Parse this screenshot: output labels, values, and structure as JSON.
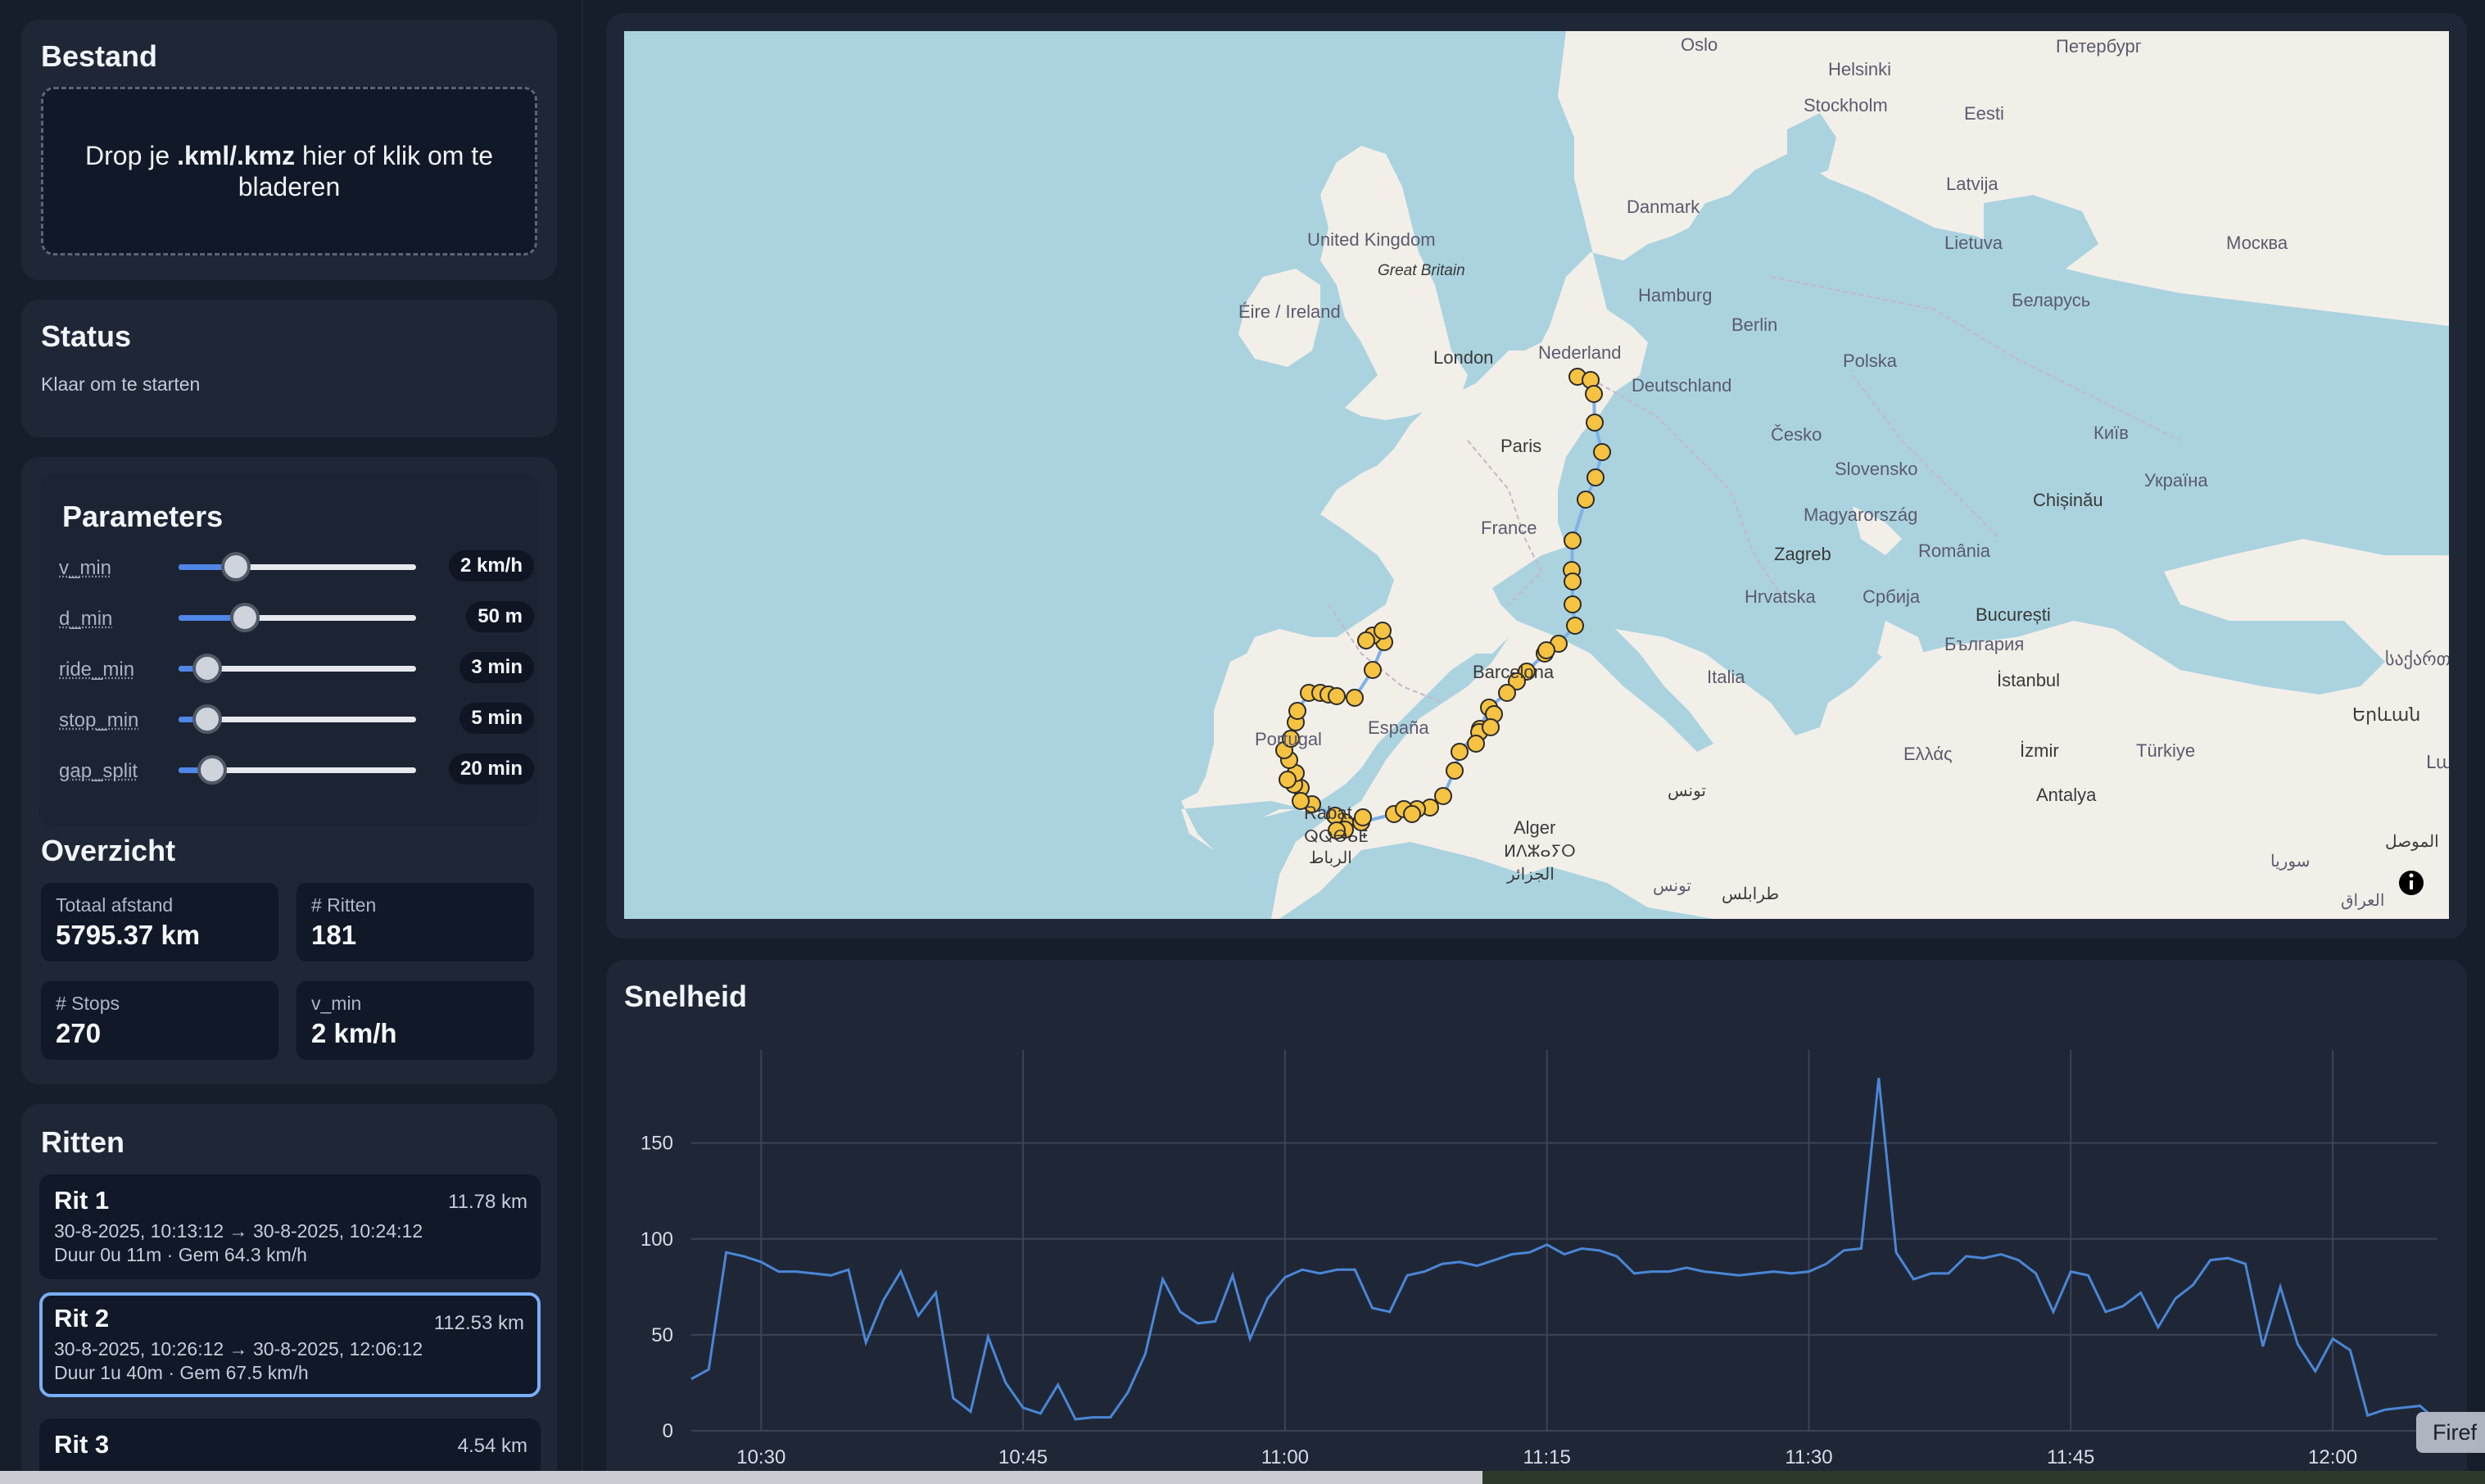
{
  "bestand": {
    "title": "Bestand",
    "drop_prefix": "Drop je ",
    "drop_bold": ".kml/.kmz",
    "drop_suffix": " hier of klik om te bladeren"
  },
  "status": {
    "title": "Status",
    "text": "Klaar om te starten"
  },
  "parameters": {
    "title": "Parameters",
    "items": [
      {
        "label": "v_min",
        "value": "2 km/h",
        "level": 0.24
      },
      {
        "label": "d_min",
        "value": "50 m",
        "level": 0.28
      },
      {
        "label": "ride_min",
        "value": "3 min",
        "level": 0.12
      },
      {
        "label": "stop_min",
        "value": "5 min",
        "level": 0.12
      },
      {
        "label": "gap_split",
        "value": "20 min",
        "level": 0.14
      }
    ]
  },
  "overzicht": {
    "title": "Overzicht",
    "stats": [
      {
        "label": "Totaal afstand",
        "value": "5795.37 km"
      },
      {
        "label": "# Ritten",
        "value": "181"
      },
      {
        "label": "# Stops",
        "value": "270"
      },
      {
        "label": "v_min",
        "value": "2 km/h"
      }
    ]
  },
  "ritten": {
    "title": "Ritten",
    "items": [
      {
        "name": "Rit 1",
        "km": "11.78 km",
        "range": "30-8-2025, 10:13:12 → 30-8-2025, 10:24:12",
        "info": "Duur 0u 11m · Gem 64.3 km/h",
        "selected": false
      },
      {
        "name": "Rit 2",
        "km": "112.53 km",
        "range": "30-8-2025, 10:26:12 → 30-8-2025, 12:06:12",
        "info": "Duur 1u 40m · Gem 67.5 km/h",
        "selected": true
      },
      {
        "name": "Rit 3",
        "km": "4.54 km",
        "range": "",
        "info": "",
        "selected": false
      }
    ]
  },
  "map": {
    "labels": [
      "Oslo",
      "Helsinki",
      "Петербург",
      "Stockholm",
      "Eesti",
      "Latvija",
      "Danmark",
      "Lietuva",
      "Москва",
      "United Kingdom",
      "Great Britain",
      "Hamburg",
      "Беларусь",
      "Éire / Ireland",
      "Berlin",
      "London",
      "Nederland",
      "Deutschland",
      "Polska",
      "Paris",
      "Česko",
      "Київ",
      "Slovensko",
      "Україна",
      "France",
      "Chișinău",
      "Magyarország",
      "Zagreb",
      "România",
      "Hrvatska",
      "Србија",
      "București",
      "България",
      "Barcelona",
      "Italia",
      "İstanbul",
      "España",
      "Portugal",
      "Ελλάς",
      "İzmir",
      "Türkiye",
      "Antalya",
      "تونس",
      "Alger",
      "ⵍⴷⵣⴰⵢⵔ",
      "الجزائر",
      "Rabat",
      "ⵕⵕⴱⴰⵟ",
      "الرباط",
      "طرابلس",
      "تونس",
      "الموصل",
      "سوريا",
      "العراق",
      "საქართველო",
      "Երևան",
      "Լարի"
    ],
    "info_icon": "info-icon"
  },
  "chart_data": {
    "type": "line",
    "title": "Snelheid",
    "x_tick_labels": [
      "10:30",
      "10:45",
      "11:00",
      "11:15",
      "11:30",
      "11:45",
      "12:00"
    ],
    "y_tick_labels": [
      "0",
      "50",
      "100",
      "150"
    ],
    "ylim": [
      0,
      190
    ],
    "x_start": "10:26",
    "x_step_minutes": 1,
    "color": "#4a86d6",
    "values": [
      27,
      32,
      93,
      91,
      88,
      83,
      83,
      82,
      81,
      84,
      46,
      68,
      83,
      60,
      72,
      17,
      10,
      49,
      25,
      12,
      9,
      24,
      6,
      7,
      7,
      20,
      40,
      79,
      62,
      56,
      57,
      81,
      48,
      69,
      80,
      84,
      82,
      84,
      84,
      64,
      62,
      81,
      83,
      87,
      88,
      86,
      89,
      92,
      93,
      97,
      92,
      95,
      94,
      91,
      82,
      83,
      83,
      85,
      83,
      82,
      81,
      82,
      83,
      82,
      83,
      87,
      94,
      95,
      184,
      93,
      79,
      82,
      82,
      91,
      90,
      92,
      89,
      82,
      62,
      83,
      81,
      62,
      65,
      72,
      54,
      69,
      76,
      89,
      90,
      87,
      44,
      75,
      45,
      31,
      48,
      42,
      8,
      11,
      12,
      13,
      5
    ]
  },
  "overlay": {
    "badge": "Firef"
  }
}
